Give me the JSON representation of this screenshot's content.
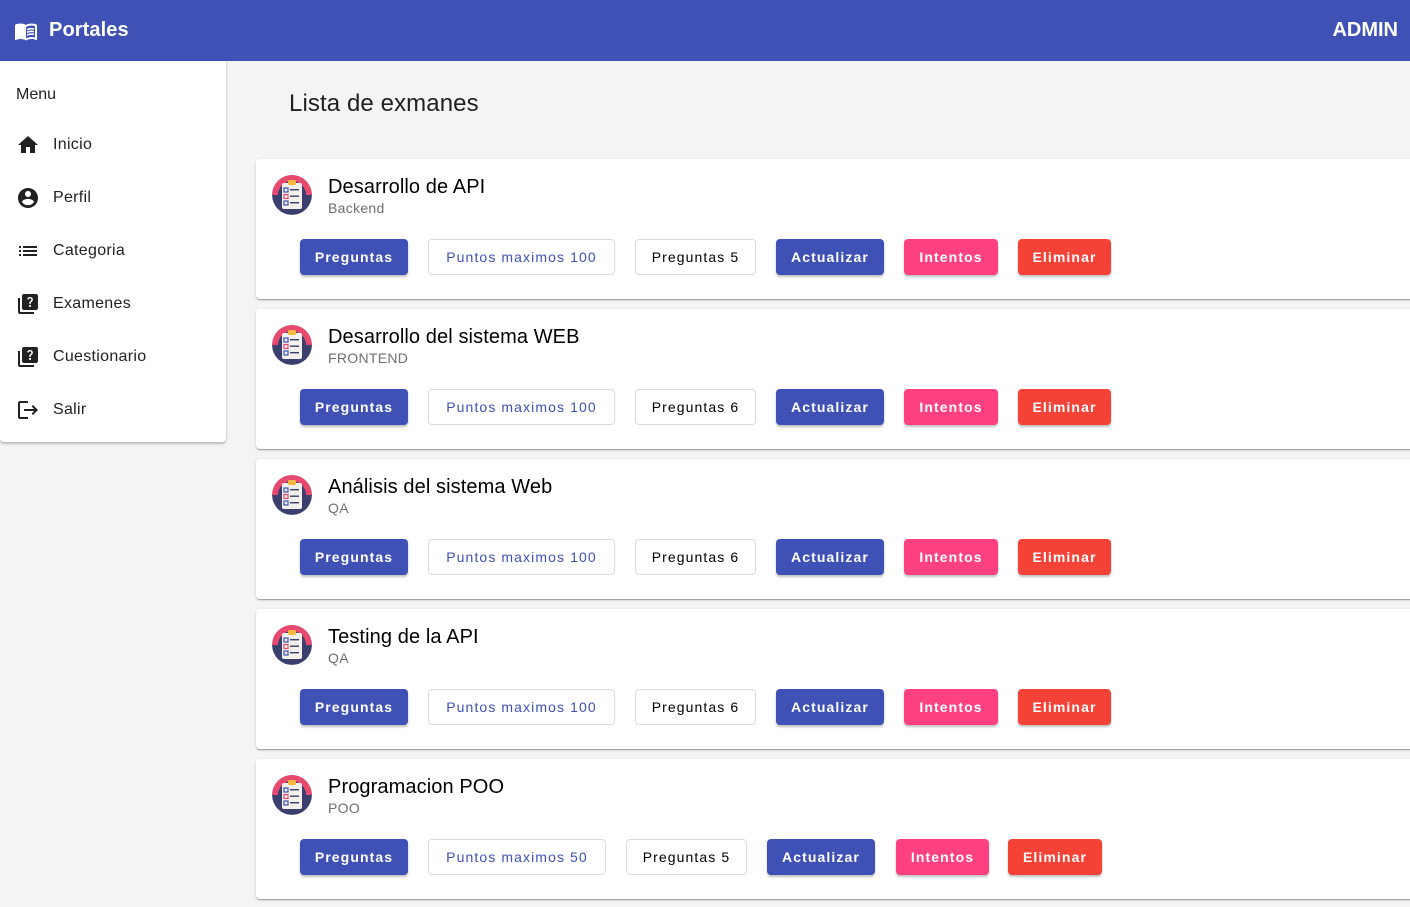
{
  "toolbar": {
    "brand_icon": "book-open-icon",
    "title": "Portales",
    "user": "ADMIN",
    "color": "#3f51b5"
  },
  "sidebar": {
    "heading": "Menu",
    "items": [
      {
        "label": "Inicio",
        "icon": "home-icon"
      },
      {
        "label": "Perfil",
        "icon": "account-circle-icon"
      },
      {
        "label": "Categoria",
        "icon": "list-icon"
      },
      {
        "label": "Examenes",
        "icon": "quiz-icon"
      },
      {
        "label": "Cuestionario",
        "icon": "quiz-icon"
      },
      {
        "label": "Salir",
        "icon": "logout-icon"
      }
    ]
  },
  "main": {
    "title": "Lista de exmanes",
    "buttons": {
      "questions": "Preguntas",
      "update": "Actualizar",
      "attempts": "Intentos",
      "delete": "Eliminar"
    },
    "exams": [
      {
        "title": "Desarrollo de API",
        "category": "Backend",
        "max_points": "Puntos maximos 100",
        "num_questions": "Preguntas 5"
      },
      {
        "title": "Desarrollo del sistema WEB",
        "category": "FRONTEND",
        "max_points": "Puntos maximos 100",
        "num_questions": "Preguntas 6"
      },
      {
        "title": "Análisis del sistema Web",
        "category": "QA",
        "max_points": "Puntos maximos 100",
        "num_questions": "Preguntas 6"
      },
      {
        "title": "Testing de la API",
        "category": "QA",
        "max_points": "Puntos maximos 100",
        "num_questions": "Preguntas 6"
      },
      {
        "title": "Programacion POO",
        "category": "POO",
        "max_points": "Puntos maximos 50",
        "num_questions": "Preguntas 5"
      }
    ]
  },
  "colors": {
    "primary": "#3f51b5",
    "accent": "#ff4081",
    "warn": "#f44336"
  }
}
